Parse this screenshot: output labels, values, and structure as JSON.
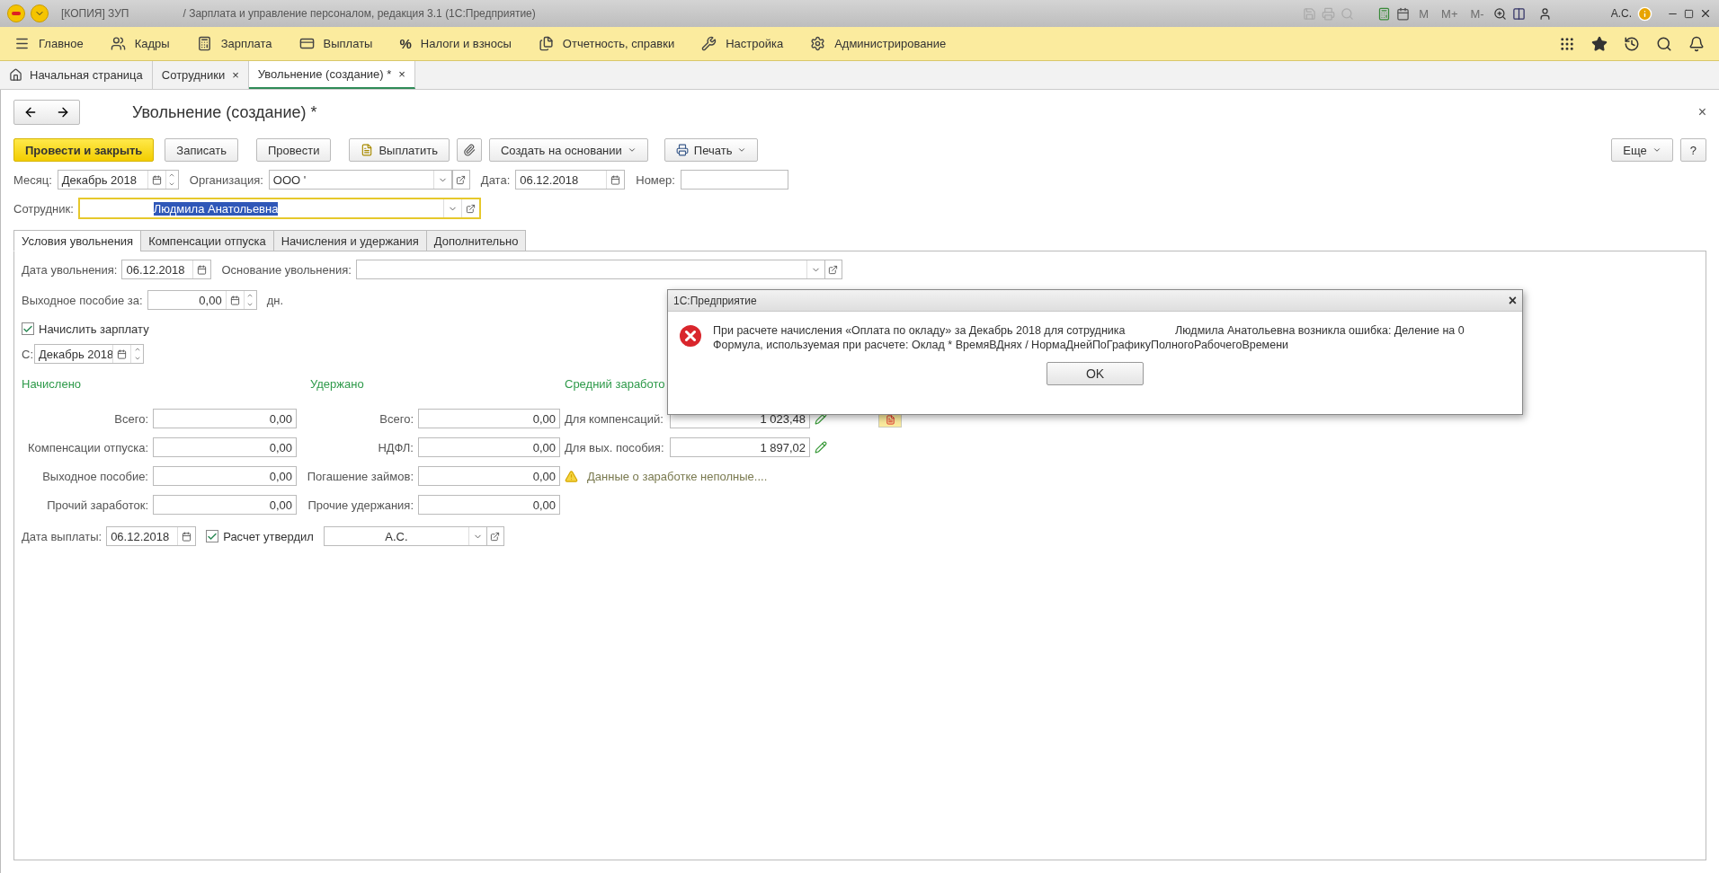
{
  "window": {
    "title": "[КОПИЯ] ЗУП",
    "subtitle": "/ Зарплата и управление персоналом, редакция 3.1  (1С:Предприятие)",
    "memory_keys": [
      "M",
      "M+",
      "M-"
    ],
    "user": "А.С."
  },
  "nav": {
    "items": [
      {
        "label": "Главное"
      },
      {
        "label": "Кадры"
      },
      {
        "label": "Зарплата"
      },
      {
        "label": "Выплаты"
      },
      {
        "label": "Налоги и взносы",
        "glyph": "%"
      },
      {
        "label": "Отчетность, справки"
      },
      {
        "label": "Настройка"
      },
      {
        "label": "Администрирование"
      }
    ]
  },
  "tabs": [
    {
      "label": "Начальная страница",
      "kind": "home",
      "selected": false
    },
    {
      "label": "Сотрудники",
      "kind": "closable",
      "close": "×",
      "selected": false
    },
    {
      "label": "Увольнение (создание) *",
      "kind": "closable",
      "close": "×",
      "selected": true
    }
  ],
  "form": {
    "title": "Увольнение (создание) *",
    "close": "×",
    "buttons": [
      {
        "label": "Провести и закрыть",
        "kind": "primary"
      },
      {
        "label": "Записать",
        "kind": "plain"
      },
      {
        "label": "Провести",
        "kind": "plain"
      },
      {
        "label": "Выплатить",
        "kind": "pay"
      },
      {
        "kind": "clip"
      },
      {
        "label": "Создать на основании",
        "kind": "dropdown"
      },
      {
        "label": "Печать",
        "kind": "print"
      }
    ],
    "more": "Еще",
    "help": "?",
    "month": {
      "label": "Месяц:",
      "value": "Декабрь 2018"
    },
    "organization": {
      "label": "Организация:",
      "value": "ООО '"
    },
    "date": {
      "label": "Дата:",
      "value": "06.12.2018"
    },
    "number": {
      "label": "Номер:"
    },
    "employee": {
      "label": "Сотрудник:",
      "value": "Людмила Анатольевна",
      "highlighted": true
    }
  },
  "sections": [
    {
      "label": "Условия увольнения",
      "selected": true
    },
    {
      "label": "Компенсации отпуска",
      "selected": false
    },
    {
      "label": "Начисления и удержания",
      "selected": false
    },
    {
      "label": "Дополнительно",
      "selected": false
    }
  ],
  "panel": {
    "dismissal_date": {
      "label": "Дата увольнения:",
      "value": "06.12.2018"
    },
    "basis": {
      "label": "Основание увольнения:"
    },
    "severance": {
      "label": "Выходное пособие за:",
      "value": "0,00",
      "unit": "дн."
    },
    "accrue_salary": {
      "label": "Начислить зарплату",
      "checked": true
    },
    "from": {
      "label": "С:",
      "value": "Декабрь 2018"
    },
    "accrued": {
      "heading": "Начислено",
      "rows": [
        {
          "label": "Всего:",
          "value": "0,00"
        },
        {
          "label": "Компенсации отпуска:",
          "value": "0,00"
        },
        {
          "label": "Выходное пособие:",
          "value": "0,00"
        },
        {
          "label": "Прочий заработок:",
          "value": "0,00"
        }
      ]
    },
    "withheld": {
      "heading": "Удержано",
      "rows": [
        {
          "label": "Всего:",
          "value": "0,00"
        },
        {
          "label": "НДФЛ:",
          "value": "0,00"
        },
        {
          "label": "Погашение займов:",
          "value": "0,00"
        },
        {
          "label": "Прочие удержания:",
          "value": "0,00"
        }
      ]
    },
    "average": {
      "heading": "Средний заработо",
      "rows": [
        {
          "label": "Для компенсаций:",
          "value": "1 023,48"
        },
        {
          "label": "Для вых. пособия:",
          "value": "1 897,02"
        }
      ],
      "warning": "Данные о заработке неполные...."
    },
    "payout_date": {
      "label": "Дата выплаты:",
      "value": "06.12.2018"
    },
    "approved": {
      "label": "Расчет утвердил",
      "checked": true,
      "value": "А.С."
    }
  },
  "dialog": {
    "title": "1С:Предприятие",
    "close": "×",
    "message": "При расчете начисления «Оплата по окладу» за Декабрь 2018 для сотрудника                Людмила Анатольевна возникла ошибка: Деление на 0",
    "formula": "Формула, используемая при расчете: Оклад * ВремяВДнях / НормаДнейПоГрафикуПолногоРабочегоВремени",
    "button": "OK"
  }
}
